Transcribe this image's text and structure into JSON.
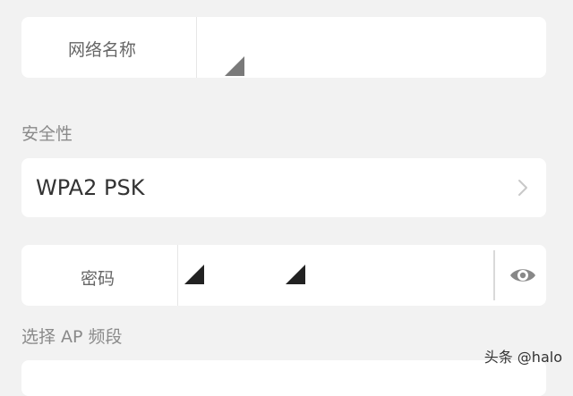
{
  "network": {
    "name_label": "网络名称",
    "name_value": ""
  },
  "security": {
    "section_label": "安全性",
    "value": "WPA2 PSK"
  },
  "password": {
    "label": "密码",
    "value": "",
    "visibility_icon": "eye-icon"
  },
  "ap_band": {
    "section_label": "选择 AP 频段"
  },
  "watermark": "头条 @halo",
  "colors": {
    "background": "#f2f2f2",
    "card": "#ffffff",
    "label": "#8a8a8a"
  }
}
